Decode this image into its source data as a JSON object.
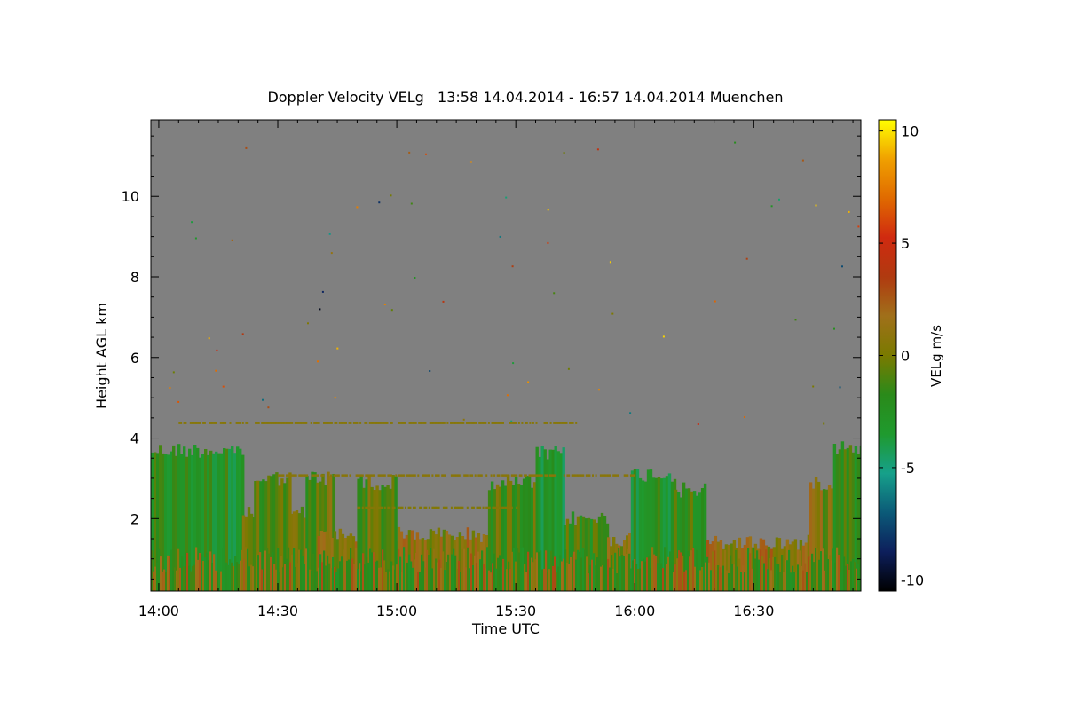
{
  "chart_data": {
    "type": "heatmap",
    "title": "Doppler Velocity VELg   13:58 14.04.2014 - 16:57 14.04.2014 Muenchen",
    "xlabel": "Time UTC",
    "ylabel": "Height AGL km",
    "colorbar_label": "VELg m/s",
    "xlim": [
      "13:58",
      "16:57"
    ],
    "ylim": [
      0.2,
      11.9
    ],
    "x_ticks": [
      "14:00",
      "14:30",
      "15:00",
      "15:30",
      "16:00",
      "16:30"
    ],
    "y_ticks": [
      "2",
      "4",
      "6",
      "8",
      "10"
    ],
    "colorbar_ticks": [
      "10",
      "5",
      "0",
      "-5",
      "-10"
    ],
    "colorbar_range": [
      -10.5,
      10.5
    ],
    "background_color": "#808080",
    "colormap": [
      "#000000",
      "#0d1f5c",
      "#0b5a78",
      "#16a08a",
      "#1f9a2e",
      "#2a8a1a",
      "#7a7a00",
      "#a0701a",
      "#b03a10",
      "#d02a10",
      "#e06a00",
      "#f0a000",
      "#ffff00"
    ],
    "grid": false,
    "legend": "none",
    "echo_regions": [
      {
        "start": "13:58",
        "end": "14:21",
        "top": 3.7,
        "velocity": -2.5
      },
      {
        "start": "14:21",
        "end": "14:40",
        "top": 2.1,
        "velocity": -0.5
      },
      {
        "start": "14:24",
        "end": "14:33",
        "top": 3.0,
        "velocity": -1.0
      },
      {
        "start": "14:37",
        "end": "14:44",
        "top": 3.0,
        "velocity": -0.5
      },
      {
        "start": "14:40",
        "end": "15:23",
        "top": 1.6,
        "velocity": 0.8
      },
      {
        "start": "14:50",
        "end": "15:00",
        "top": 2.9,
        "velocity": -0.8
      },
      {
        "start": "15:23",
        "end": "15:35",
        "top": 2.9,
        "velocity": -1.0
      },
      {
        "start": "15:35",
        "end": "15:42",
        "top": 3.6,
        "velocity": -3.0
      },
      {
        "start": "15:42",
        "end": "15:53",
        "top": 2.0,
        "velocity": -1.5
      },
      {
        "start": "15:53",
        "end": "15:59",
        "top": 1.5,
        "velocity": 0.5
      },
      {
        "start": "15:59",
        "end": "16:10",
        "top": 3.1,
        "velocity": -2.5
      },
      {
        "start": "16:10",
        "end": "16:18",
        "top": 2.7,
        "velocity": -1.2
      },
      {
        "start": "16:18",
        "end": "16:44",
        "top": 1.4,
        "velocity": 1.0
      },
      {
        "start": "16:44",
        "end": "16:50",
        "top": 2.9,
        "velocity": 0.3
      },
      {
        "start": "16:50",
        "end": "16:57",
        "top": 3.8,
        "velocity": -2.0
      }
    ]
  }
}
